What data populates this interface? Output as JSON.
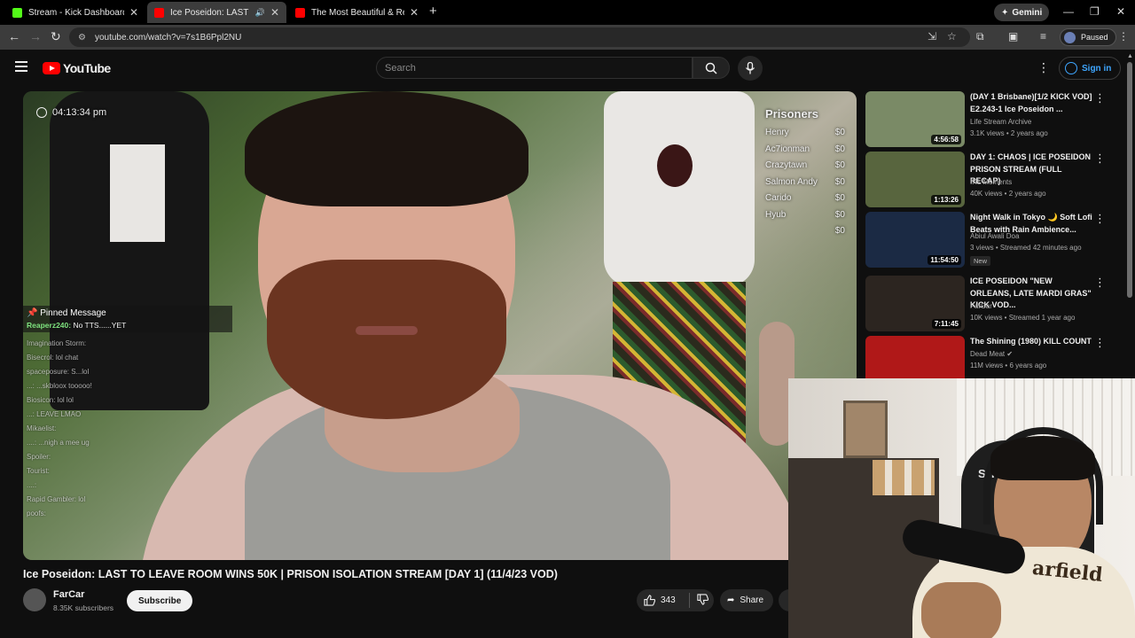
{
  "browser": {
    "tabs": [
      {
        "title": "Stream - Kick Dashboard",
        "favicon_color": "#53fc18"
      },
      {
        "title": "Ice Poseidon: LAST TO LEAVE",
        "favicon_color": "#ff0000"
      },
      {
        "title": "The Most Beautiful & Relaxing",
        "favicon_color": "#ff0000"
      }
    ],
    "gemini_label": "Gemini",
    "url": "youtube.com/watch?v=7s1B6Ppl2NU",
    "profile_status": "Paused"
  },
  "youtube": {
    "logo_text": "YouTube",
    "search_placeholder": "Search",
    "signin_label": "Sign in"
  },
  "overlay": {
    "clock": "04:13:34 pm",
    "prisoners_title": "Prisoners",
    "prisoners": [
      {
        "name": "Henry",
        "amount": "$0"
      },
      {
        "name": "Ac7ionman",
        "amount": "$0"
      },
      {
        "name": "Crazytawn",
        "amount": "$0"
      },
      {
        "name": "Salmon Andy",
        "amount": "$0"
      },
      {
        "name": "Carido",
        "amount": "$0"
      },
      {
        "name": "Hyub",
        "amount": "$0"
      },
      {
        "name": "",
        "amount": "$0"
      }
    ],
    "pinned_title": "Pinned Message",
    "pinned_user": "Reaperz240:",
    "pinned_text": "No TTS......YET",
    "chat_lines": [
      "Imagination Storm:",
      "Bisecrol: lol chat",
      "spaceposure: S...lol",
      "...: ...skbloox tooooo!",
      "Biosicon: lol lol",
      "...: LEAVE LMAO",
      "Mikaelist:",
      "....: ...nigh a mee ug",
      "Spoiler:",
      "Tourist:",
      "....:",
      "Rapid Gambler: lol",
      "poofs:"
    ]
  },
  "video": {
    "title": "Ice Poseidon: LAST TO LEAVE ROOM WINS 50K | PRISON ISOLATION STREAM [DAY 1] (11/4/23 VOD)",
    "channel": "FarCar",
    "subscribers": "8.35K subscribers",
    "subscribe_label": "Subscribe",
    "likes": "343",
    "share_label": "Share"
  },
  "recommendations": [
    {
      "title": "(DAY 1 Brisbane)[1/2 KICK VOD] E2.243-1 Ice Poseidon ...",
      "channel": "Life Stream Archive",
      "meta": "3.1K views • 2 years ago",
      "duration": "4:56:58",
      "badge": "",
      "thumb_color": "#7a8a66"
    },
    {
      "title": "DAY 1: CHAOS | ICE POSEIDON PRISON STREAM (FULL RECAP)",
      "channel": "IRL Moments",
      "meta": "40K views • 2 years ago",
      "duration": "1:13:26",
      "badge": "",
      "thumb_color": "#58653e"
    },
    {
      "title": "Night Walk in Tokyo 🌙 Soft Lofi Beats with Rain Ambience...",
      "channel": "Abiul Awali Doa",
      "meta": "3 views • Streamed 42 minutes ago",
      "duration": "11:54:50",
      "badge": "New",
      "thumb_color": "#1b2a44"
    },
    {
      "title": "ICE POSEIDON \"NEW ORLEANS, LATE MARDI GRAS\" KICK VOD...",
      "channel": "FarCar",
      "meta": "10K views • Streamed 1 year ago",
      "duration": "7:11:45",
      "badge": "",
      "thumb_color": "#2c2520"
    },
    {
      "title": "The Shining (1980) KILL COUNT",
      "channel": "Dead Meat ✔",
      "meta": "11M views • 6 years ago",
      "duration": "",
      "badge": "",
      "thumb_color": "#b01818"
    }
  ],
  "webcam": {
    "chair_text": "S-RAC",
    "shirt_text": "arfield"
  }
}
